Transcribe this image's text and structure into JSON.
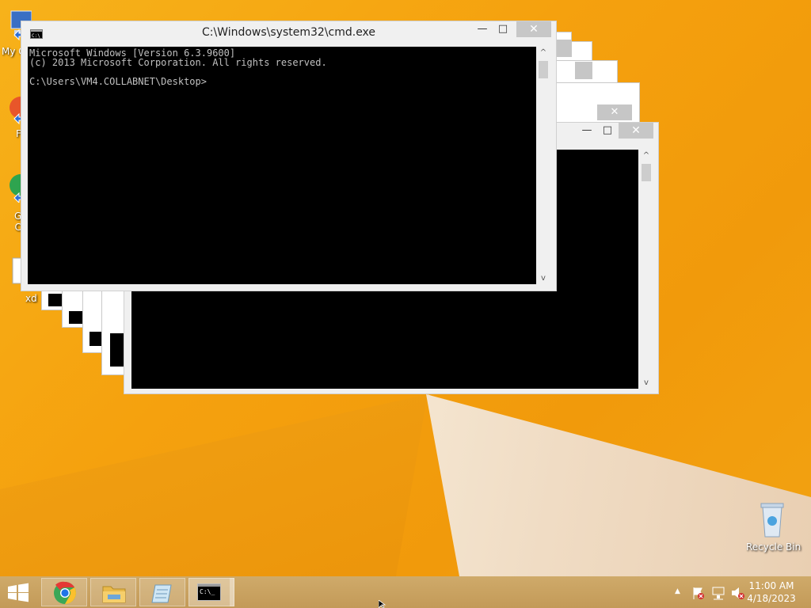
{
  "desktop": {
    "icons": [
      {
        "name": "My C",
        "label": "My C"
      },
      {
        "name": "F",
        "label": "F"
      },
      {
        "name": "G C",
        "label": "G\nC"
      },
      {
        "name": "xd",
        "label": "xd"
      }
    ],
    "recycle_bin_label": "Recycle Bin"
  },
  "cmd_window": {
    "title": "C:\\Windows\\system32\\cmd.exe",
    "minimize": "—",
    "maximize": "□",
    "close": "✕",
    "console_text": "Microsoft Windows [Version 6.3.9600]\n(c) 2013 Microsoft Corporation. All rights reserved.\n\nC:\\Users\\VM4.COLLABNET\\Desktop>",
    "scroll_up": "^",
    "scroll_down": "v"
  },
  "back_window": {
    "minimize": "—",
    "maximize": "□",
    "close": "✕",
    "scroll_up": "^",
    "scroll_down": "v"
  },
  "taskbar": {
    "apps": [
      "start",
      "chrome",
      "file-explorer",
      "notepad",
      "cmd"
    ],
    "clock_time": "11:00 AM",
    "clock_date": "4/18/2023",
    "tray_chevron": "▲"
  }
}
